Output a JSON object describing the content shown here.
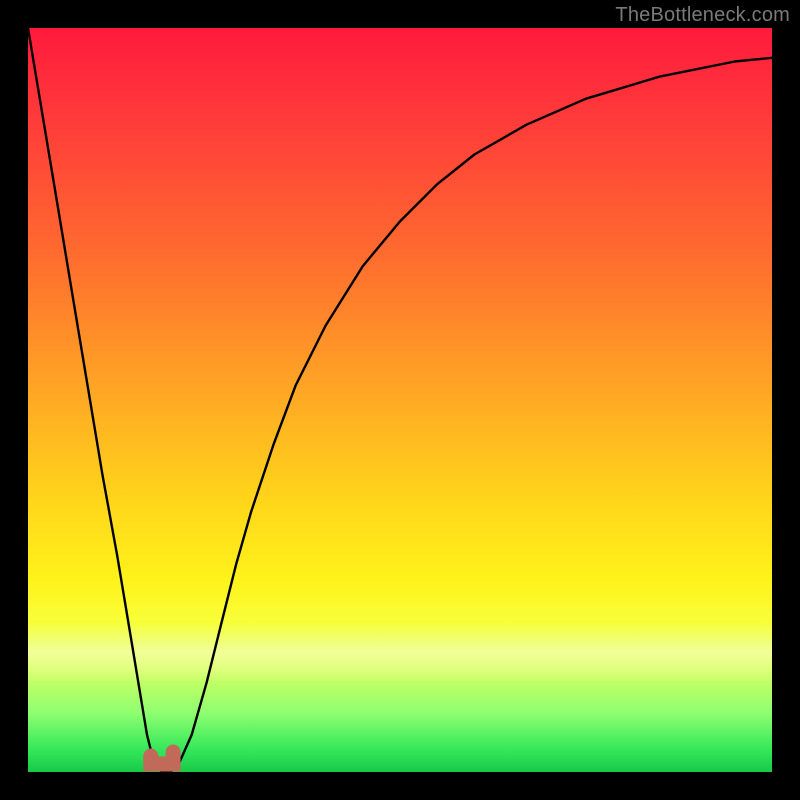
{
  "watermark": {
    "text": "TheBottleneck.com"
  },
  "colors": {
    "frame": "#000000",
    "curve": "#000000",
    "marker": "#c26a5a",
    "gradient_stops": [
      "#ff1a3c",
      "#ff3a3a",
      "#ff6a2f",
      "#ffa425",
      "#ffd41a",
      "#fff21a",
      "#f7ff3a",
      "#d6ff60",
      "#8fff70",
      "#34e85a",
      "#18c94a"
    ]
  },
  "chart_data": {
    "type": "line",
    "title": "",
    "xlabel": "",
    "ylabel": "",
    "xlim": [
      0,
      100
    ],
    "ylim": [
      0,
      100
    ],
    "grid": false,
    "legend": false,
    "series": [
      {
        "name": "bottleneck-curve",
        "x": [
          0,
          2,
          4,
          6,
          8,
          10,
          12,
          14,
          15,
          16,
          17,
          18,
          19,
          20,
          22,
          24,
          26,
          28,
          30,
          33,
          36,
          40,
          45,
          50,
          55,
          60,
          67,
          75,
          85,
          95,
          100
        ],
        "values": [
          100,
          88,
          76,
          64,
          52,
          40,
          29,
          17,
          11,
          5,
          1,
          0,
          0,
          0.5,
          5,
          12,
          20,
          28,
          35,
          44,
          52,
          60,
          68,
          74,
          79,
          83,
          87,
          90.5,
          93.5,
          95.5,
          96
        ]
      }
    ],
    "marker": {
      "name": "optimal-range",
      "x_range": [
        16.5,
        19.5
      ],
      "y": 0
    }
  }
}
